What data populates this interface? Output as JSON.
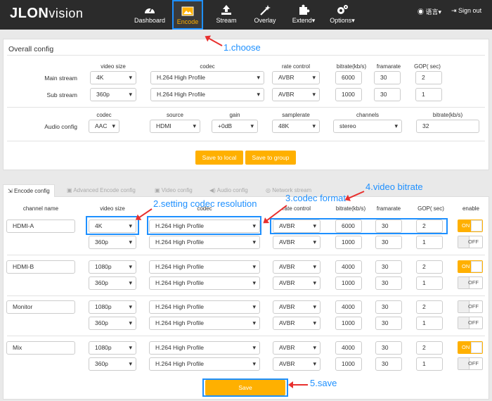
{
  "logo": {
    "main": "JLON",
    "sub": "vision"
  },
  "nav": [
    {
      "label": "Dashboard",
      "icon": "dashboard-icon"
    },
    {
      "label": "Encode",
      "icon": "image-icon"
    },
    {
      "label": "Stream",
      "icon": "upload-icon"
    },
    {
      "label": "Overlay",
      "icon": "magic-wand-icon"
    },
    {
      "label": "Extend▾",
      "icon": "puzzle-icon"
    },
    {
      "label": "Options▾",
      "icon": "gears-icon"
    }
  ],
  "nav_right": {
    "language": "语言▾",
    "signout": "Sign out"
  },
  "overall": {
    "title": "Overall config",
    "headers": {
      "video_size": "video size",
      "codec": "codec",
      "rate_control": "rate control",
      "bitrate": "bitrate(kb/s)",
      "framerate": "framarate",
      "gop": "GOP( sec)"
    },
    "rows": [
      {
        "label": "Main stream",
        "size": "4K",
        "codec": "H.264 High Profile",
        "rc": "AVBR",
        "bitrate": "6000",
        "fps": "30",
        "gop": "2"
      },
      {
        "label": "Sub stream",
        "size": "360p",
        "codec": "H.264 High Profile",
        "rc": "AVBR",
        "bitrate": "1000",
        "fps": "30",
        "gop": "1"
      }
    ],
    "audio_headers": {
      "codec": "codec",
      "source": "source",
      "gain": "gain",
      "samplerate": "samplerate",
      "channels": "channels",
      "bitrate": "bitrate(kb/s)"
    },
    "audio": {
      "label": "Audio config",
      "codec": "AAC",
      "source": "HDMI",
      "gain": "+0dB",
      "samplerate": "48K",
      "channels": "stereo",
      "bitrate": "32"
    },
    "save_local": "Save to local",
    "save_group": "Save to group"
  },
  "tabs": [
    "Encode config",
    "Advanced Encode config",
    "Video config",
    "Audio config",
    "Network stream"
  ],
  "encode": {
    "headers": {
      "channel": "channel name",
      "size": "video size",
      "codec": "codec",
      "rc": "rate control",
      "bitrate": "bitrate(kb/s)",
      "fps": "framarate",
      "gop": "GOP( sec)",
      "enable": "enable"
    },
    "channels": [
      {
        "name": "HDMI-A",
        "rows": [
          {
            "size": "4K",
            "codec": "H.264 High Profile",
            "rc": "AVBR",
            "bitrate": "6000",
            "fps": "30",
            "gop": "2",
            "enable": "ON"
          },
          {
            "size": "360p",
            "codec": "H.264 High Profile",
            "rc": "AVBR",
            "bitrate": "1000",
            "fps": "30",
            "gop": "1",
            "enable": "OFF"
          }
        ]
      },
      {
        "name": "HDMI-B",
        "rows": [
          {
            "size": "1080p",
            "codec": "H.264 High Profile",
            "rc": "AVBR",
            "bitrate": "4000",
            "fps": "30",
            "gop": "2",
            "enable": "ON"
          },
          {
            "size": "360p",
            "codec": "H.264 High Profile",
            "rc": "AVBR",
            "bitrate": "1000",
            "fps": "30",
            "gop": "1",
            "enable": "OFF"
          }
        ]
      },
      {
        "name": "Monitor",
        "rows": [
          {
            "size": "1080p",
            "codec": "H.264 High Profile",
            "rc": "AVBR",
            "bitrate": "4000",
            "fps": "30",
            "gop": "2",
            "enable": "OFF"
          },
          {
            "size": "360p",
            "codec": "H.264 High Profile",
            "rc": "AVBR",
            "bitrate": "1000",
            "fps": "30",
            "gop": "1",
            "enable": "OFF"
          }
        ]
      },
      {
        "name": "Mix",
        "rows": [
          {
            "size": "1080p",
            "codec": "H.264 High Profile",
            "rc": "AVBR",
            "bitrate": "4000",
            "fps": "30",
            "gop": "2",
            "enable": "ON"
          },
          {
            "size": "360p",
            "codec": "H.264 High Profile",
            "rc": "AVBR",
            "bitrate": "1000",
            "fps": "30",
            "gop": "1",
            "enable": "OFF"
          }
        ]
      }
    ],
    "save": "Save"
  },
  "annotations": {
    "a1": "1.choose",
    "a2": "2.setting codec resolution",
    "a3": "3.codec format",
    "a4": "4.video bitrate",
    "a5": "5.save"
  },
  "colors": {
    "accent": "#ffb000",
    "highlight": "#1e90ff",
    "arrow": "#e8302e",
    "topbar": "#2b2b2b"
  }
}
